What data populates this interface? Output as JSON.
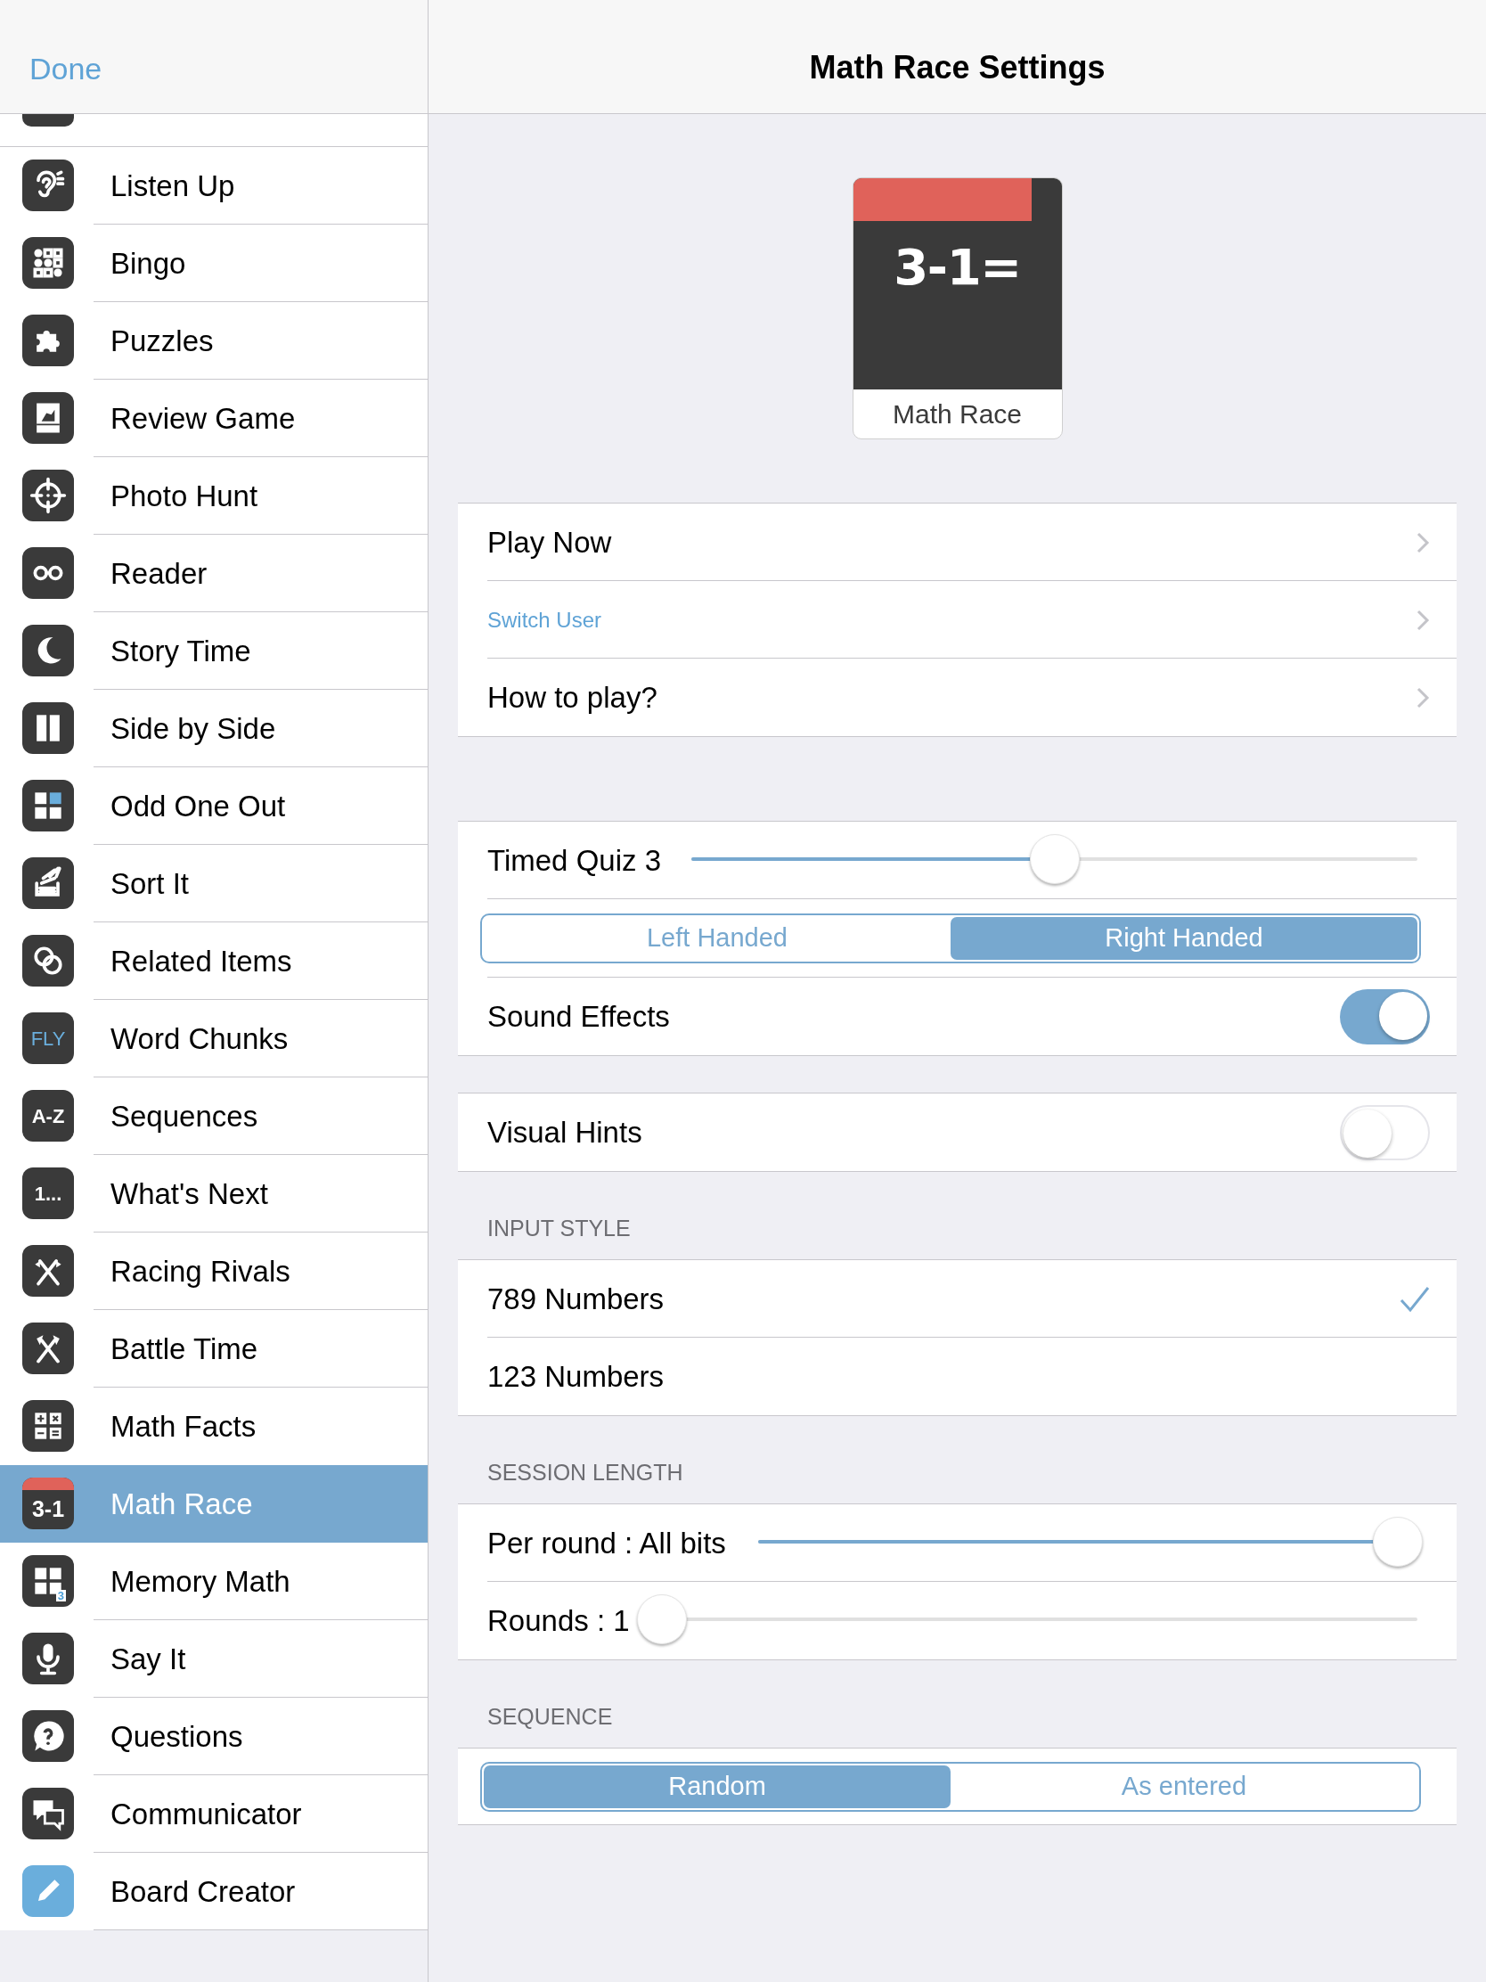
{
  "header": {
    "done": "Done",
    "title": "Math Race Settings"
  },
  "sidebar": {
    "items": [
      {
        "label": "Listen Up",
        "selected": false
      },
      {
        "label": "Bingo",
        "selected": false
      },
      {
        "label": "Puzzles",
        "selected": false
      },
      {
        "label": "Review Game",
        "selected": false
      },
      {
        "label": "Photo Hunt",
        "selected": false
      },
      {
        "label": "Reader",
        "selected": false
      },
      {
        "label": "Story Time",
        "selected": false
      },
      {
        "label": "Side by Side",
        "selected": false
      },
      {
        "label": "Odd One Out",
        "selected": false
      },
      {
        "label": "Sort It",
        "selected": false
      },
      {
        "label": "Related Items",
        "selected": false
      },
      {
        "label": "Word Chunks",
        "selected": false,
        "icon_text": "FLY"
      },
      {
        "label": "Sequences",
        "selected": false,
        "icon_text": "A-Z"
      },
      {
        "label": "What's Next",
        "selected": false,
        "icon_text": "1..."
      },
      {
        "label": "Racing Rivals",
        "selected": false
      },
      {
        "label": "Battle Time",
        "selected": false
      },
      {
        "label": "Math Facts",
        "selected": false
      },
      {
        "label": "Math Race",
        "selected": true,
        "icon_text": "3-1"
      },
      {
        "label": "Memory Math",
        "selected": false,
        "icon_text": "3"
      },
      {
        "label": "Say It",
        "selected": false
      },
      {
        "label": "Questions",
        "selected": false
      },
      {
        "label": "Communicator",
        "selected": false
      },
      {
        "label": "Board Creator",
        "selected": false
      }
    ]
  },
  "game_card": {
    "art_text": "3-1=",
    "label": "Math Race"
  },
  "nav_rows": [
    {
      "label": "Play Now",
      "kind": "large"
    },
    {
      "label": "Switch User",
      "kind": "small"
    },
    {
      "label": "How to play?",
      "kind": "large"
    }
  ],
  "timed_quiz": {
    "label": "Timed Quiz 3",
    "level": 0.5
  },
  "handedness": [
    {
      "label": "Left Handed",
      "selected": false
    },
    {
      "label": "Right Handed",
      "selected": true
    }
  ],
  "sound_effects": {
    "label": "Sound Effects",
    "on": true
  },
  "visual_hints": {
    "label": "Visual Hints",
    "on": false
  },
  "input_style": {
    "header": "INPUT STYLE",
    "options": [
      {
        "label": "789 Numbers",
        "selected": true
      },
      {
        "label": "123 Numbers",
        "selected": false
      }
    ]
  },
  "session_length": {
    "header": "SESSION LENGTH",
    "sliders": [
      {
        "label": "Per round : All bits",
        "level": 0.97
      },
      {
        "label": "Rounds : 1",
        "level": 0
      }
    ]
  },
  "sequence": {
    "header": "SEQUENCE",
    "options": [
      {
        "label": "Random",
        "selected": true
      },
      {
        "label": "As entered",
        "selected": false
      }
    ]
  }
}
